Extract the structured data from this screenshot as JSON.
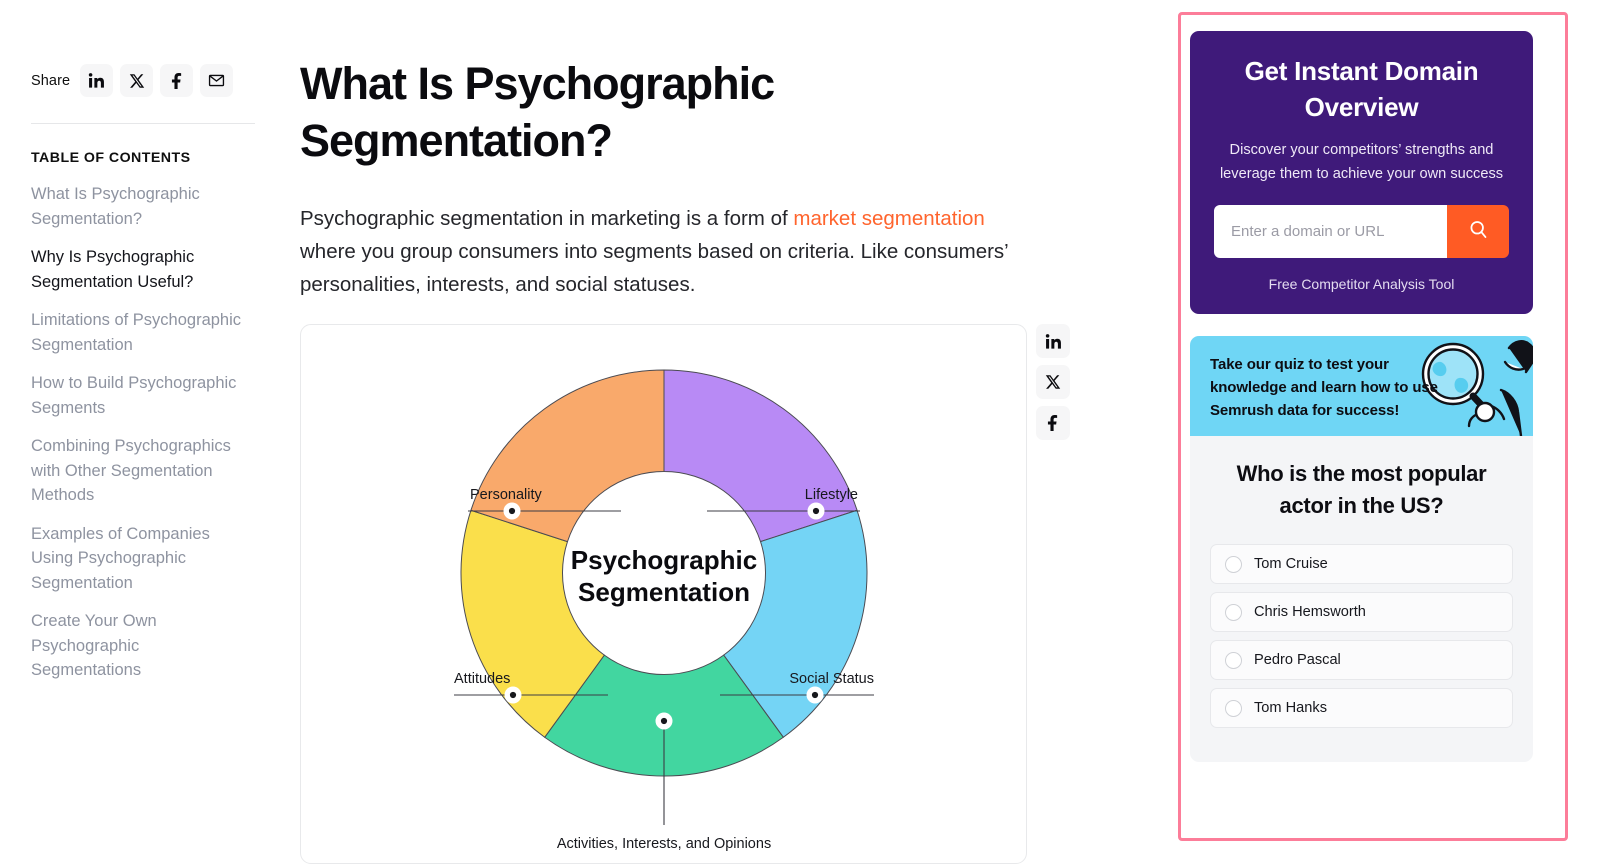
{
  "left_rail": {
    "share_label": "Share",
    "share_buttons": [
      {
        "name": "linkedin",
        "icon": "linkedin-icon"
      },
      {
        "name": "x-twitter",
        "icon": "x-icon"
      },
      {
        "name": "facebook",
        "icon": "facebook-icon"
      },
      {
        "name": "email",
        "icon": "email-icon"
      }
    ],
    "toc_title": "TABLE OF CONTENTS",
    "toc_items": [
      {
        "label": "What Is Psychographic Segmentation?",
        "active": false
      },
      {
        "label": "Why Is Psychographic Segmentation Useful?",
        "active": true
      },
      {
        "label": "Limitations of Psychographic Segmentation",
        "active": false
      },
      {
        "label": "How to Build Psychographic Segments",
        "active": false
      },
      {
        "label": "Combining Psychographics with Other Segmentation Methods",
        "active": false
      },
      {
        "label": "Examples of Companies Using Psychographic Segmentation",
        "active": false
      },
      {
        "label": "Create Your Own Psychographic Segmentations",
        "active": false
      }
    ]
  },
  "article": {
    "heading": "What Is Psychographic Segmentation?",
    "paragraph_part1": "Psychographic segmentation in marketing is a form of ",
    "paragraph_link": "market segmentation",
    "paragraph_part2": " where you group consumers into segments based on criteria. Like consumers’ personalities, interests, and social statuses.",
    "link_color": "#ff642d"
  },
  "vertical_share": [
    {
      "name": "linkedin",
      "icon": "linkedin-icon"
    },
    {
      "name": "x-twitter",
      "icon": "x-icon"
    },
    {
      "name": "facebook",
      "icon": "facebook-icon"
    }
  ],
  "chart_data": {
    "type": "pie",
    "title": "Psychographic Segmentation",
    "center_label_line1": "Psychographic",
    "center_label_line2": "Segmentation",
    "categories": [
      "Lifestyle",
      "Social Status",
      "Activities, Interests, and Opinions",
      "Attitudes",
      "Personality"
    ],
    "values": [
      20,
      20,
      20,
      20,
      20
    ],
    "colors": [
      "#b88af5",
      "#74d4f5",
      "#42d6a0",
      "#fadf4b",
      "#f9a96b"
    ],
    "legend_position": "callout-labels",
    "grid": false,
    "donut": true,
    "labels": [
      {
        "text": "Lifestyle",
        "color": "#b88af5",
        "side": "right"
      },
      {
        "text": "Social Status",
        "color": "#74d4f5",
        "side": "right"
      },
      {
        "text": "Activities, Interests, and Opinions",
        "color": "#42d6a0",
        "side": "bottom"
      },
      {
        "text": "Attitudes",
        "color": "#fadf4b",
        "side": "left"
      },
      {
        "text": "Personality",
        "color": "#f9a96b",
        "side": "left"
      }
    ]
  },
  "sidebar": {
    "highlight_border_color": "#fc7d99",
    "promo": {
      "title": "Get Instant Domain Overview",
      "subtitle": "Discover your competitors’ strengths and leverage them to achieve your own success",
      "input_placeholder": "Enter a domain or URL",
      "input_value": "",
      "search_icon": "search-icon",
      "footer_label": "Free Competitor Analysis Tool",
      "bg_color": "#3f1a7a",
      "button_color": "#ff5b24"
    },
    "quiz": {
      "banner_text": "Take our quiz to test your knowledge and learn how to use Semrush data for success!",
      "banner_bg": "#6fd6f5",
      "question": "Who is the most popular actor in the US?",
      "options": [
        {
          "label": "Tom Cruise",
          "selected": false
        },
        {
          "label": "Chris Hemsworth",
          "selected": false
        },
        {
          "label": "Pedro Pascal",
          "selected": false
        },
        {
          "label": "Tom Hanks",
          "selected": false
        }
      ]
    }
  }
}
